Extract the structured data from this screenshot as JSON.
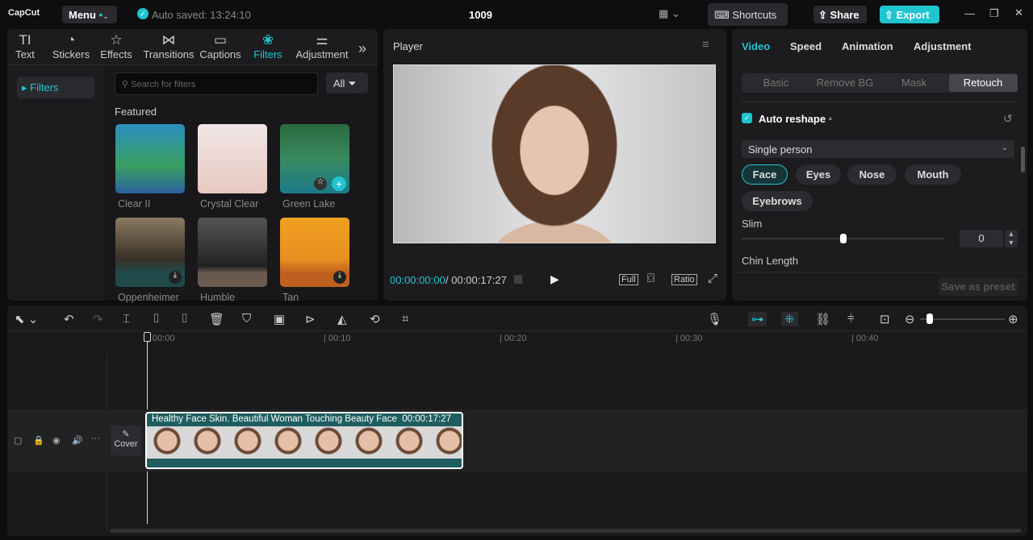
{
  "app": {
    "logo": "CapCut",
    "menu": "Menu",
    "autosave": "Auto saved: 13:24:10",
    "project": "1009",
    "shortcuts": "Shortcuts",
    "share": "Share",
    "export": "Export"
  },
  "tabs": [
    {
      "label": "Text",
      "icon": "TI"
    },
    {
      "label": "Stickers",
      "icon": "◔"
    },
    {
      "label": "Effects",
      "icon": "☆"
    },
    {
      "label": "Transitions",
      "icon": "⋈"
    },
    {
      "label": "Captions",
      "icon": "▭"
    },
    {
      "label": "Filters",
      "icon": "❀"
    },
    {
      "label": "Adjustment",
      "icon": "⚌"
    }
  ],
  "filters": {
    "side": "Filters",
    "search_placeholder": "Search for filters",
    "all": "All",
    "featured": "Featured",
    "items": [
      {
        "name": "Clear II",
        "bg": "linear-gradient(#2a8fc0,#3aa060 60%,#2a60a0)"
      },
      {
        "name": "Crystal Clear",
        "bg": "linear-gradient(#f0e6e6,#e8c8c0)"
      },
      {
        "name": "Green Lake",
        "bg": "linear-gradient(#2a6a40,#3a8a60 50%,#1a7a8a)"
      },
      {
        "name": "Oppenheimer",
        "bg": "linear-gradient(#8a7a60,#3a3028 60%,#1e4a4a 80%)"
      },
      {
        "name": "Humble",
        "bg": "linear-gradient(#555,#222 70%,#6a5a50 80%)"
      },
      {
        "name": "Tan",
        "bg": "linear-gradient(#f0a020,#e89020 60%,#c06020 80%)"
      }
    ]
  },
  "player": {
    "title": "Player",
    "current": "00:00:00:00",
    "total": "00:00:17:27",
    "full": "Full",
    "ratio": "Ratio"
  },
  "inspector": {
    "tabs": [
      "Video",
      "Speed",
      "Animation",
      "Adjustment"
    ],
    "subtabs": [
      "Basic",
      "Remove BG",
      "Mask",
      "Retouch"
    ],
    "auto_reshape": "Auto reshape",
    "mode": "Single person",
    "parts": [
      "Face",
      "Eyes",
      "Nose",
      "Mouth",
      "Eyebrows"
    ],
    "slim": "Slim",
    "slim_value": "0",
    "chin": "Chin Length",
    "save_preset": "Save as preset"
  },
  "timeline": {
    "ticks": [
      "00:00",
      "00:10",
      "00:20",
      "00:30",
      "00:40"
    ],
    "clip_title": "Healthy Face Skin. Beautiful Woman Touching Beauty Face",
    "clip_duration": "00:00:17:27",
    "cover": "Cover"
  }
}
